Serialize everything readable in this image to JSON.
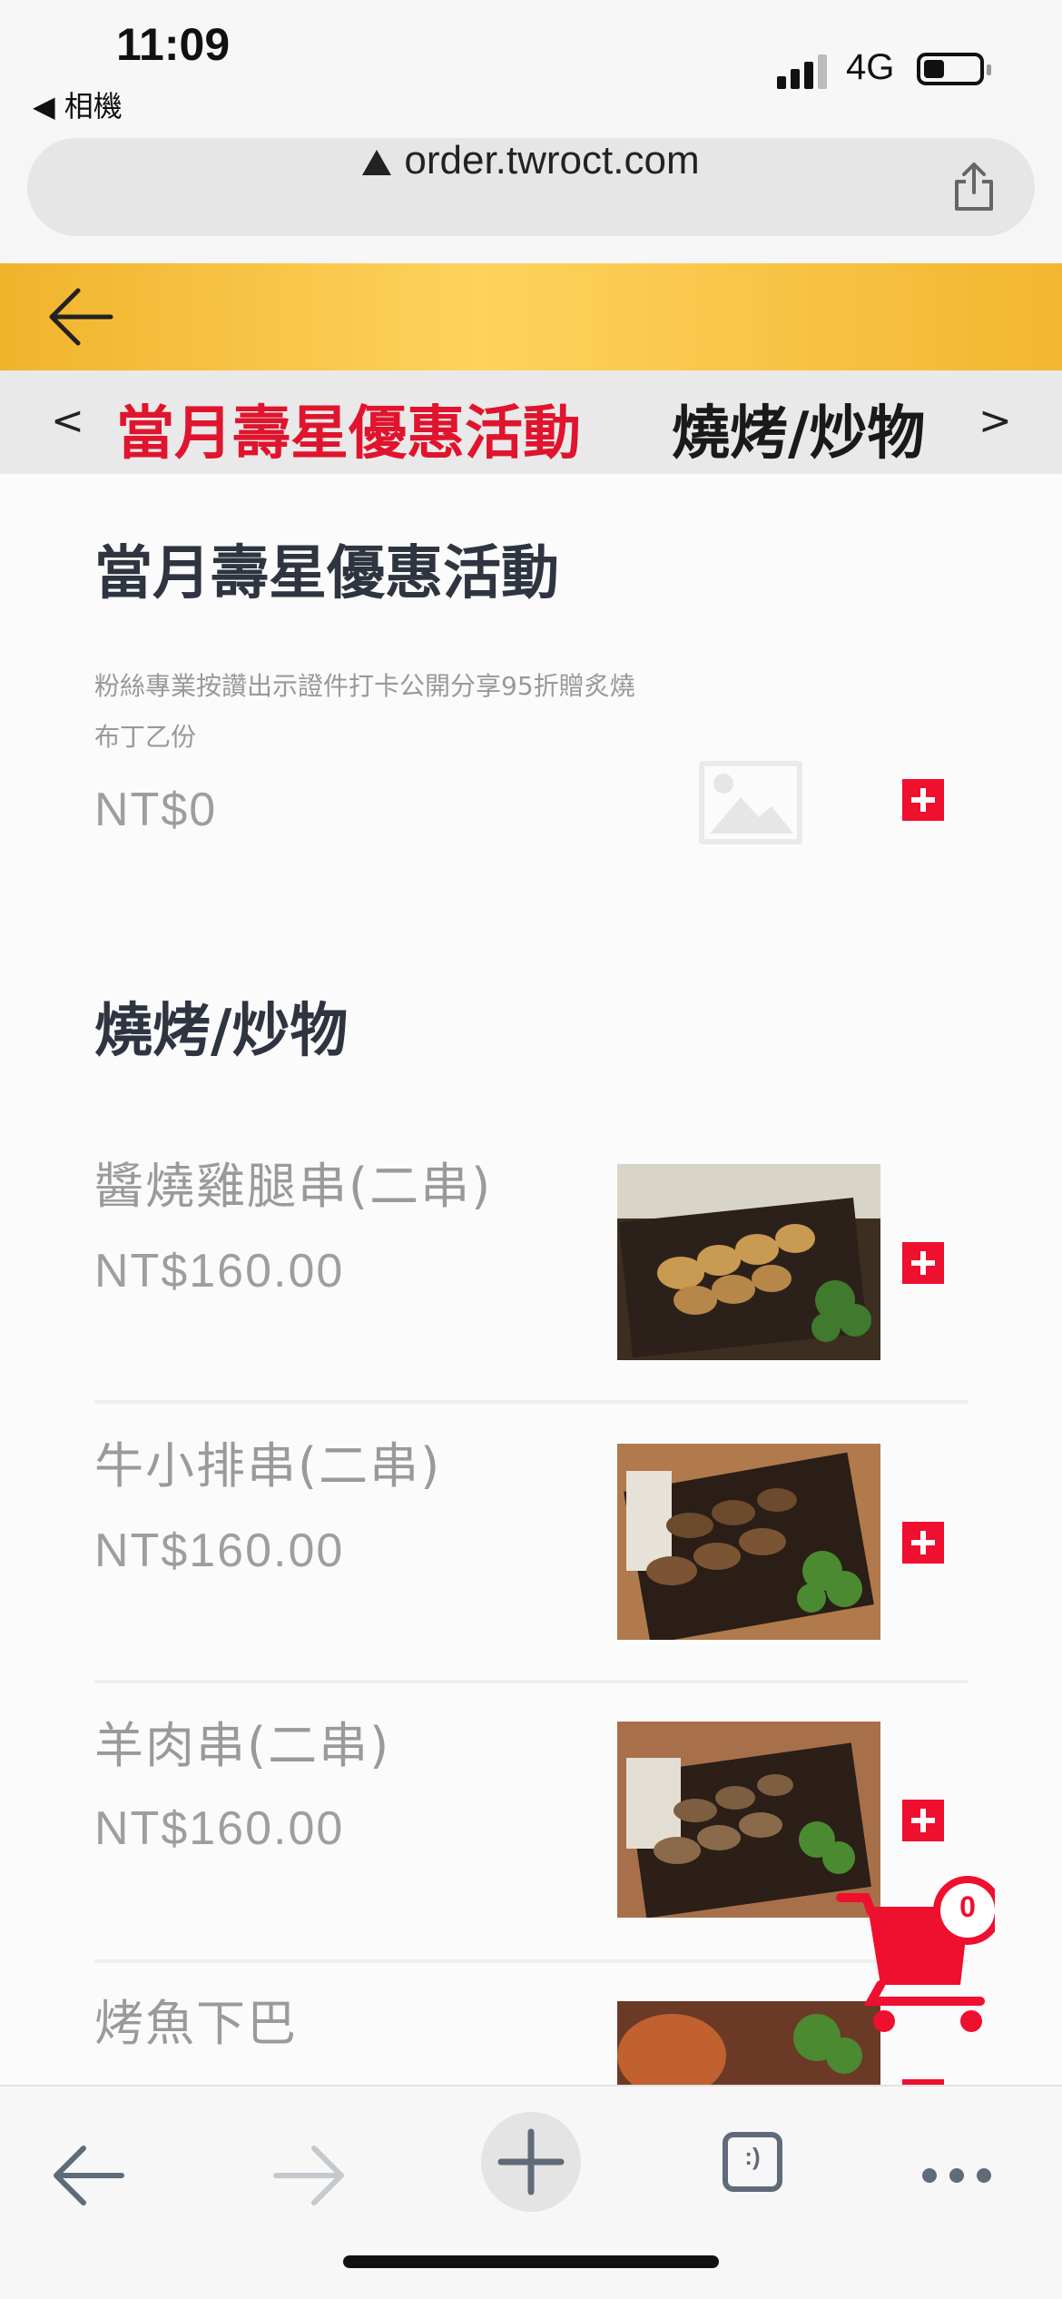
{
  "status_bar": {
    "time": "11:09",
    "back_app": "◀ 相機",
    "network": "4G"
  },
  "browser": {
    "url": "order.twroct.com"
  },
  "category_tabs": {
    "prev": "<",
    "next": ">",
    "items": [
      {
        "label": "當月壽星優惠活動",
        "active": true
      },
      {
        "label": "燒烤/炒物",
        "active": false
      }
    ]
  },
  "sections": [
    {
      "title": "當月壽星優惠活動",
      "items": [
        {
          "name": "",
          "description": "粉絲專業按讚出示證件打卡公開分享95折贈炙燒布丁乙份",
          "price": "NT$0",
          "image": "placeholder-image-icon"
        }
      ]
    },
    {
      "title": "燒烤/炒物",
      "items": [
        {
          "name": "醬燒雞腿串(二串)",
          "price": "NT$160.00",
          "image": "chicken-skewer-photo"
        },
        {
          "name": "牛小排串(二串)",
          "price": "NT$160.00",
          "image": "beef-skewer-photo"
        },
        {
          "name": "羊肉串(二串)",
          "price": "NT$160.00",
          "image": "lamb-skewer-photo"
        },
        {
          "name": "烤魚下巴",
          "price": "",
          "image": "fish-jaw-photo"
        }
      ]
    }
  ],
  "cart": {
    "count": "0"
  },
  "colors": {
    "accent": "#ef0f2e",
    "header": "#f7c443",
    "active_tab": "#e0142d"
  },
  "toolbar": {
    "icons": [
      "back-arrow-icon",
      "forward-arrow-icon",
      "new-tab-plus-icon",
      "tabs-icon",
      "more-icon"
    ],
    "tabs_label": ":)"
  }
}
